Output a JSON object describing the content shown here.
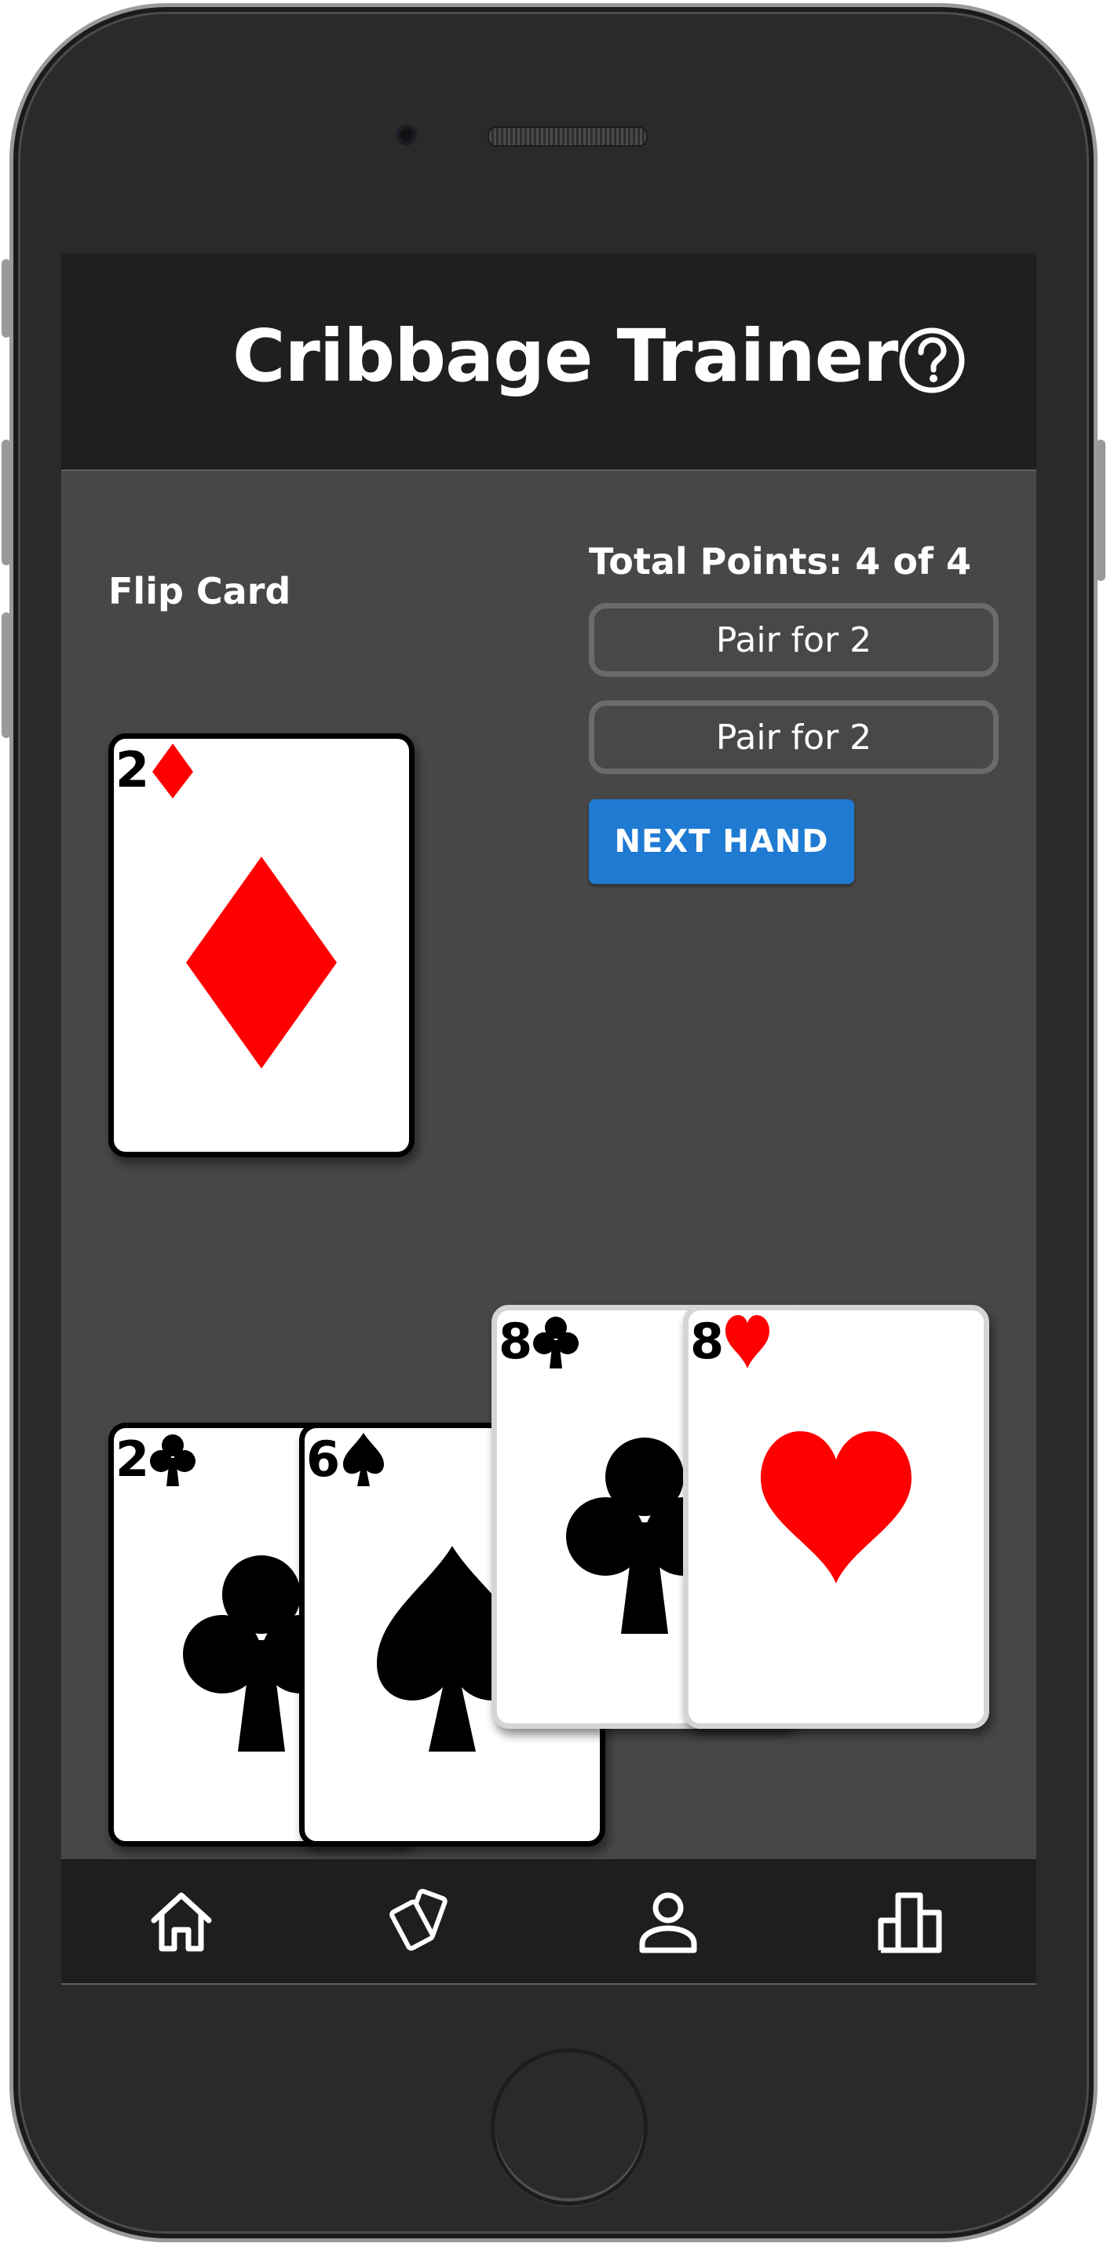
{
  "header": {
    "title": "Cribbage Trainer",
    "help_icon": "help-circle-icon"
  },
  "flip": {
    "label": "Flip Card",
    "card": {
      "rank": "2",
      "suit": "diamonds"
    }
  },
  "scoring": {
    "total_points": "Total Points: 4 of 4",
    "items": [
      {
        "label": "Pair for 2"
      },
      {
        "label": "Pair for 2"
      }
    ],
    "next_label": "NEXT HAND"
  },
  "hand": {
    "cards": [
      {
        "rank": "2",
        "suit": "clubs",
        "selected": false
      },
      {
        "rank": "6",
        "suit": "spades",
        "selected": false
      },
      {
        "rank": "8",
        "suit": "clubs",
        "selected": true
      },
      {
        "rank": "8",
        "suit": "hearts",
        "selected": true
      }
    ]
  },
  "bottom_nav": {
    "items": [
      {
        "icon": "home-icon"
      },
      {
        "icon": "cards-icon"
      },
      {
        "icon": "person-icon"
      },
      {
        "icon": "leaderboard-icon"
      }
    ]
  },
  "colors": {
    "screen_bg": "#474747",
    "header_bg": "#1f1f1f",
    "accent": "#1f7ad2",
    "red_suit": "#ff0000",
    "black_suit": "#000000"
  }
}
